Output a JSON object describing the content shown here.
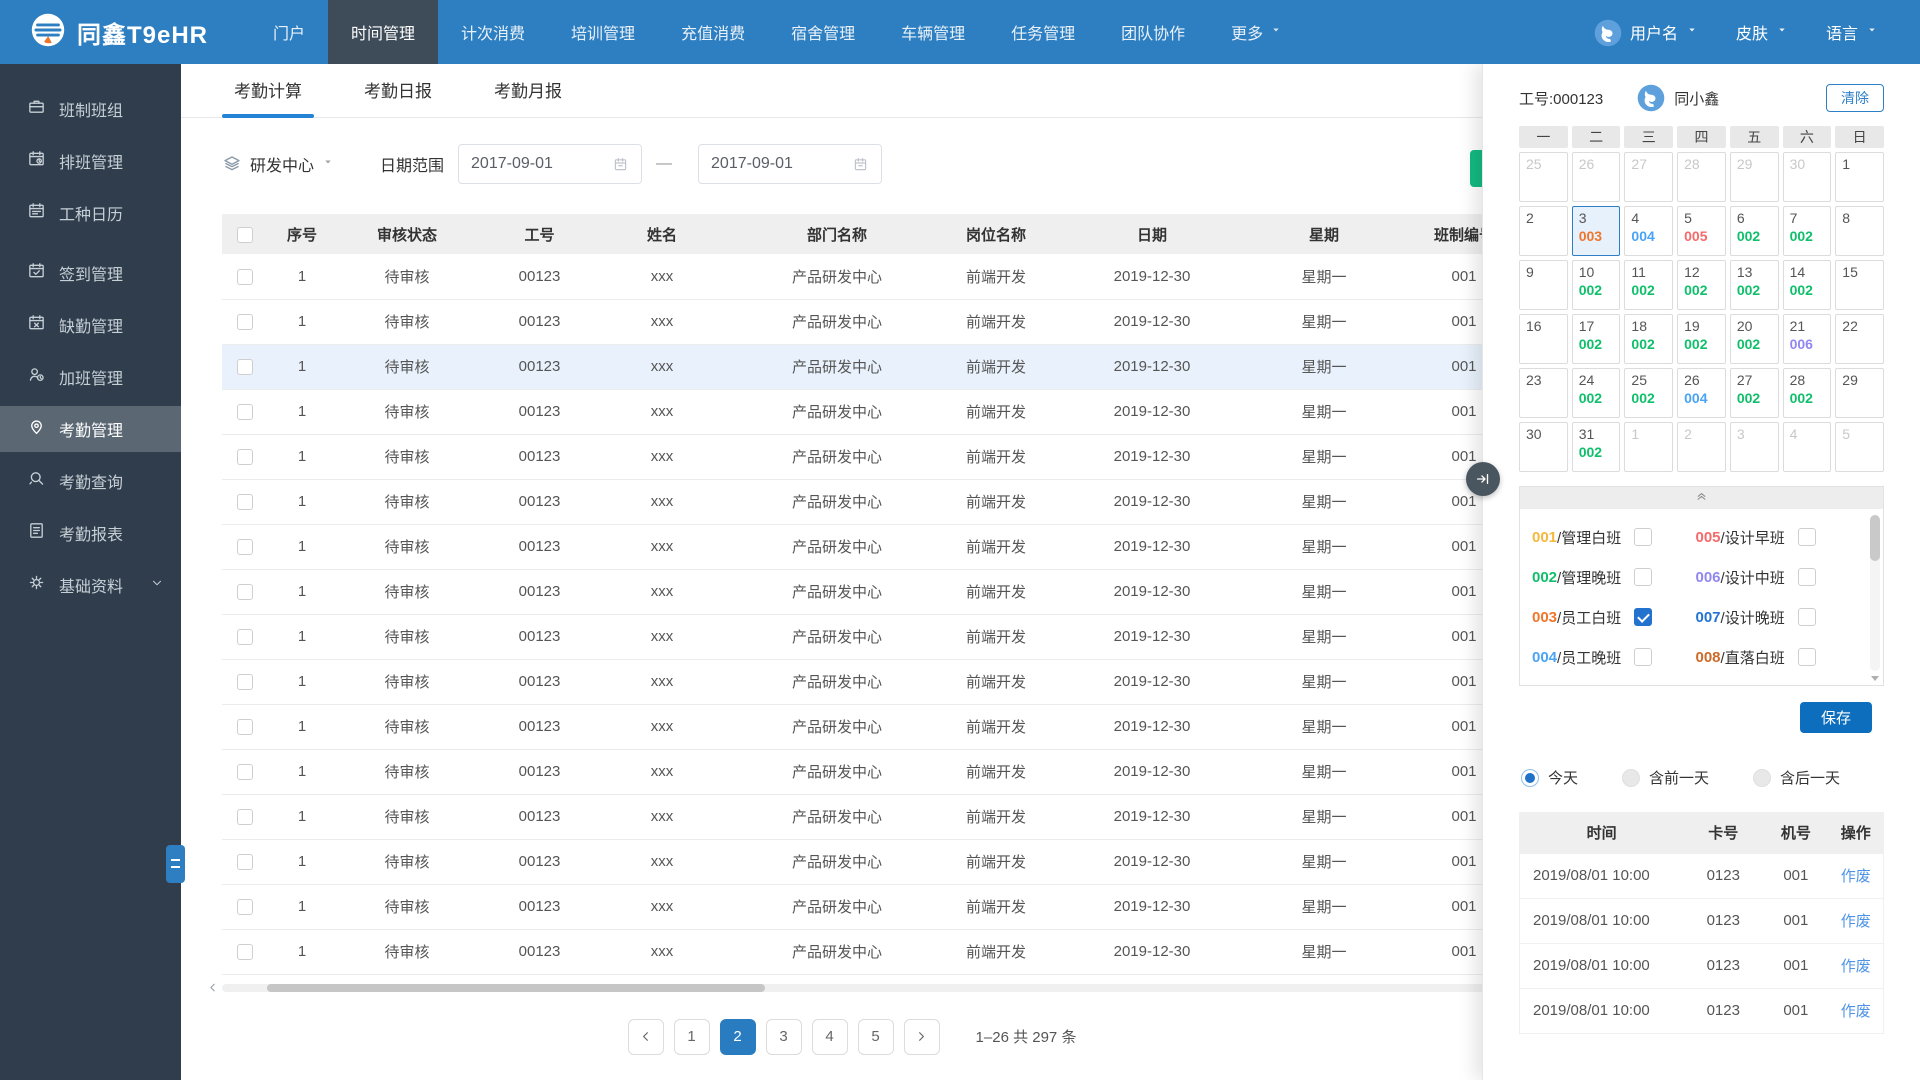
{
  "navbar": {
    "logo_text": "同鑫T9eHR",
    "items": [
      {
        "label": "门户"
      },
      {
        "label": "时间管理",
        "active": true
      },
      {
        "label": "计次消费"
      },
      {
        "label": "培训管理"
      },
      {
        "label": "充值消费"
      },
      {
        "label": "宿舍管理"
      },
      {
        "label": "车辆管理"
      },
      {
        "label": "任务管理"
      },
      {
        "label": "团队协作"
      },
      {
        "label": "更多",
        "caret": true
      }
    ],
    "user_name": "用户名",
    "skin_label": "皮肤",
    "language_label": "语言"
  },
  "sidebar": {
    "items": [
      {
        "icon": "briefcase",
        "label": "班制班组"
      },
      {
        "icon": "calendar-clock",
        "label": "排班管理"
      },
      {
        "icon": "calendar",
        "label": "工种日历"
      },
      {
        "icon": "calendar-check",
        "label": "签到管理",
        "group_start": true
      },
      {
        "icon": "calendar-x",
        "label": "缺勤管理"
      },
      {
        "icon": "user-clock",
        "label": "加班管理"
      },
      {
        "icon": "map-pin",
        "label": "考勤管理",
        "active": true
      },
      {
        "icon": "search",
        "label": "考勤查询"
      },
      {
        "icon": "report",
        "label": "考勤报表"
      },
      {
        "icon": "gear",
        "label": "基础资料",
        "expandable": true
      }
    ]
  },
  "main": {
    "tabs": [
      {
        "label": "考勤计算",
        "active": true
      },
      {
        "label": "考勤日报"
      },
      {
        "label": "考勤月报"
      }
    ],
    "filters": {
      "department": "研发中心",
      "date_range_label": "日期范围",
      "date_from": "2017-09-01",
      "date_to": "2017-09-01"
    },
    "table": {
      "columns": [
        "序号",
        "审核状态",
        "工号",
        "姓名",
        "部门名称",
        "岗位名称",
        "日期",
        "星期",
        "班制编号"
      ],
      "highlighted_row": 3,
      "rows": [
        [
          "1",
          "待审核",
          "00123",
          "xxx",
          "产品研发中心",
          "前端开发",
          "2019-12-30",
          "星期一",
          "001"
        ],
        [
          "1",
          "待审核",
          "00123",
          "xxx",
          "产品研发中心",
          "前端开发",
          "2019-12-30",
          "星期一",
          "001"
        ],
        [
          "1",
          "待审核",
          "00123",
          "xxx",
          "产品研发中心",
          "前端开发",
          "2019-12-30",
          "星期一",
          "001"
        ],
        [
          "1",
          "待审核",
          "00123",
          "xxx",
          "产品研发中心",
          "前端开发",
          "2019-12-30",
          "星期一",
          "001"
        ],
        [
          "1",
          "待审核",
          "00123",
          "xxx",
          "产品研发中心",
          "前端开发",
          "2019-12-30",
          "星期一",
          "001"
        ],
        [
          "1",
          "待审核",
          "00123",
          "xxx",
          "产品研发中心",
          "前端开发",
          "2019-12-30",
          "星期一",
          "001"
        ],
        [
          "1",
          "待审核",
          "00123",
          "xxx",
          "产品研发中心",
          "前端开发",
          "2019-12-30",
          "星期一",
          "001"
        ],
        [
          "1",
          "待审核",
          "00123",
          "xxx",
          "产品研发中心",
          "前端开发",
          "2019-12-30",
          "星期一",
          "001"
        ],
        [
          "1",
          "待审核",
          "00123",
          "xxx",
          "产品研发中心",
          "前端开发",
          "2019-12-30",
          "星期一",
          "001"
        ],
        [
          "1",
          "待审核",
          "00123",
          "xxx",
          "产品研发中心",
          "前端开发",
          "2019-12-30",
          "星期一",
          "001"
        ],
        [
          "1",
          "待审核",
          "00123",
          "xxx",
          "产品研发中心",
          "前端开发",
          "2019-12-30",
          "星期一",
          "001"
        ],
        [
          "1",
          "待审核",
          "00123",
          "xxx",
          "产品研发中心",
          "前端开发",
          "2019-12-30",
          "星期一",
          "001"
        ],
        [
          "1",
          "待审核",
          "00123",
          "xxx",
          "产品研发中心",
          "前端开发",
          "2019-12-30",
          "星期一",
          "001"
        ],
        [
          "1",
          "待审核",
          "00123",
          "xxx",
          "产品研发中心",
          "前端开发",
          "2019-12-30",
          "星期一",
          "001"
        ],
        [
          "1",
          "待审核",
          "00123",
          "xxx",
          "产品研发中心",
          "前端开发",
          "2019-12-30",
          "星期一",
          "001"
        ],
        [
          "1",
          "待审核",
          "00123",
          "xxx",
          "产品研发中心",
          "前端开发",
          "2019-12-30",
          "星期一",
          "001"
        ]
      ]
    },
    "pagination": {
      "pages": [
        "1",
        "2",
        "3",
        "4",
        "5"
      ],
      "active_page": "2",
      "summary": "1–26 共 297 条"
    }
  },
  "panel": {
    "employee_label": "工号:000123",
    "employee_name": "同小鑫",
    "clear_label": "清除",
    "weekdays": [
      "一",
      "二",
      "三",
      "四",
      "五",
      "六",
      "日"
    ],
    "calendar_cells": [
      {
        "d": "25",
        "muted": true
      },
      {
        "d": "26",
        "muted": true
      },
      {
        "d": "27",
        "muted": true
      },
      {
        "d": "28",
        "muted": true
      },
      {
        "d": "29",
        "muted": true
      },
      {
        "d": "30",
        "muted": true
      },
      {
        "d": "1"
      },
      {
        "d": "2"
      },
      {
        "d": "3",
        "code": "003",
        "selected": true
      },
      {
        "d": "4",
        "code": "004"
      },
      {
        "d": "5",
        "code": "005"
      },
      {
        "d": "6",
        "code": "002"
      },
      {
        "d": "7",
        "code": "002"
      },
      {
        "d": "8"
      },
      {
        "d": "9"
      },
      {
        "d": "10",
        "code": "002"
      },
      {
        "d": "11",
        "code": "002"
      },
      {
        "d": "12",
        "code": "002"
      },
      {
        "d": "13",
        "code": "002"
      },
      {
        "d": "14",
        "code": "002"
      },
      {
        "d": "15"
      },
      {
        "d": "16"
      },
      {
        "d": "17",
        "code": "002"
      },
      {
        "d": "18",
        "code": "002"
      },
      {
        "d": "19",
        "code": "002"
      },
      {
        "d": "20",
        "code": "002"
      },
      {
        "d": "21",
        "code": "006"
      },
      {
        "d": "22"
      },
      {
        "d": "23"
      },
      {
        "d": "24",
        "code": "002"
      },
      {
        "d": "25",
        "code": "002"
      },
      {
        "d": "26",
        "code": "004"
      },
      {
        "d": "27",
        "code": "002"
      },
      {
        "d": "28",
        "code": "002"
      },
      {
        "d": "29"
      },
      {
        "d": "30"
      },
      {
        "d": "31",
        "code": "002"
      },
      {
        "d": "1",
        "muted": true
      },
      {
        "d": "2",
        "muted": true
      },
      {
        "d": "3",
        "muted": true
      },
      {
        "d": "4",
        "muted": true
      },
      {
        "d": "5",
        "muted": true
      }
    ],
    "shifts": [
      {
        "code": "001",
        "name": "管理白班",
        "checked": false
      },
      {
        "code": "002",
        "name": "管理晚班",
        "checked": false
      },
      {
        "code": "003",
        "name": "员工白班",
        "checked": true
      },
      {
        "code": "004",
        "name": "员工晚班",
        "checked": false
      },
      {
        "code": "005",
        "name": "设计早班",
        "checked": false
      },
      {
        "code": "006",
        "name": "设计中班",
        "checked": false
      },
      {
        "code": "007",
        "name": "设计晚班",
        "checked": false
      },
      {
        "code": "008",
        "name": "直落白班",
        "checked": false
      }
    ],
    "save_label": "保存",
    "day_options": [
      {
        "label": "今天",
        "selected": true
      },
      {
        "label": "含前一天",
        "selected": false
      },
      {
        "label": "含后一天",
        "selected": false
      }
    ],
    "log_table": {
      "columns": [
        "时间",
        "卡号",
        "机号",
        "操作"
      ],
      "rows": [
        [
          "2019/08/01 10:00",
          "0123",
          "001",
          "作废"
        ],
        [
          "2019/08/01 10:00",
          "0123",
          "001",
          "作废"
        ],
        [
          "2019/08/01 10:00",
          "0123",
          "001",
          "作废"
        ],
        [
          "2019/08/01 10:00",
          "0123",
          "001",
          "作废"
        ]
      ]
    }
  },
  "colors": {
    "navbar": "#2E7FC1",
    "accent_blue": "#2483D5",
    "green_button": "#13BA83",
    "shift_codes": {
      "001": "#F5B83D",
      "002": "#10BF6B",
      "003": "#F0762B",
      "004": "#4AA3F5",
      "005": "#F56A6A",
      "006": "#9187F0",
      "007": "#2273D3",
      "008": "#CE6A28"
    }
  }
}
